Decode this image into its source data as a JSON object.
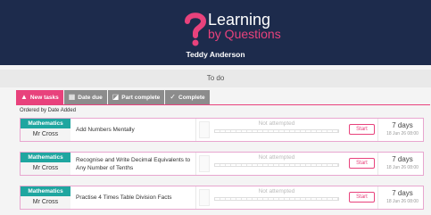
{
  "header": {
    "logo_title": "Learning",
    "logo_subtitle": "by Questions",
    "user_name": "Teddy Anderson",
    "colors": {
      "background": "#1d2b4c",
      "accent": "#e8427c"
    }
  },
  "todo_title": "To do",
  "tabs": [
    {
      "label": "New tasks",
      "icon": "warning-icon",
      "active": true
    },
    {
      "label": "Date due",
      "icon": "calendar-icon",
      "active": false
    },
    {
      "label": "Part complete",
      "icon": "part-complete-icon",
      "active": false
    },
    {
      "label": "Complete",
      "icon": "check-circle-icon",
      "active": false
    }
  ],
  "order_label": "Ordered by Date Added",
  "tasks": [
    {
      "subject": "Mathematics",
      "teacher": "Mr Cross",
      "title": "Add Numbers Mentally",
      "status": "Not attempted",
      "button": "Start",
      "due_days": "7 days",
      "due_date": "18 Jun 26 08:00"
    },
    {
      "subject": "Mathematics",
      "teacher": "Mr Cross",
      "title": "Recognise and Write Decimal Equivalents to Any Number of Tenths",
      "status": "Not attempted",
      "button": "Start",
      "due_days": "7 days",
      "due_date": "18 Jun 26 08:00"
    },
    {
      "subject": "Mathematics",
      "teacher": "Mr Cross",
      "title": "Practise 4 Times Table Division Facts",
      "status": "Not attempted",
      "button": "Start",
      "due_days": "7 days",
      "due_date": "18 Jun 26 08:00"
    }
  ]
}
